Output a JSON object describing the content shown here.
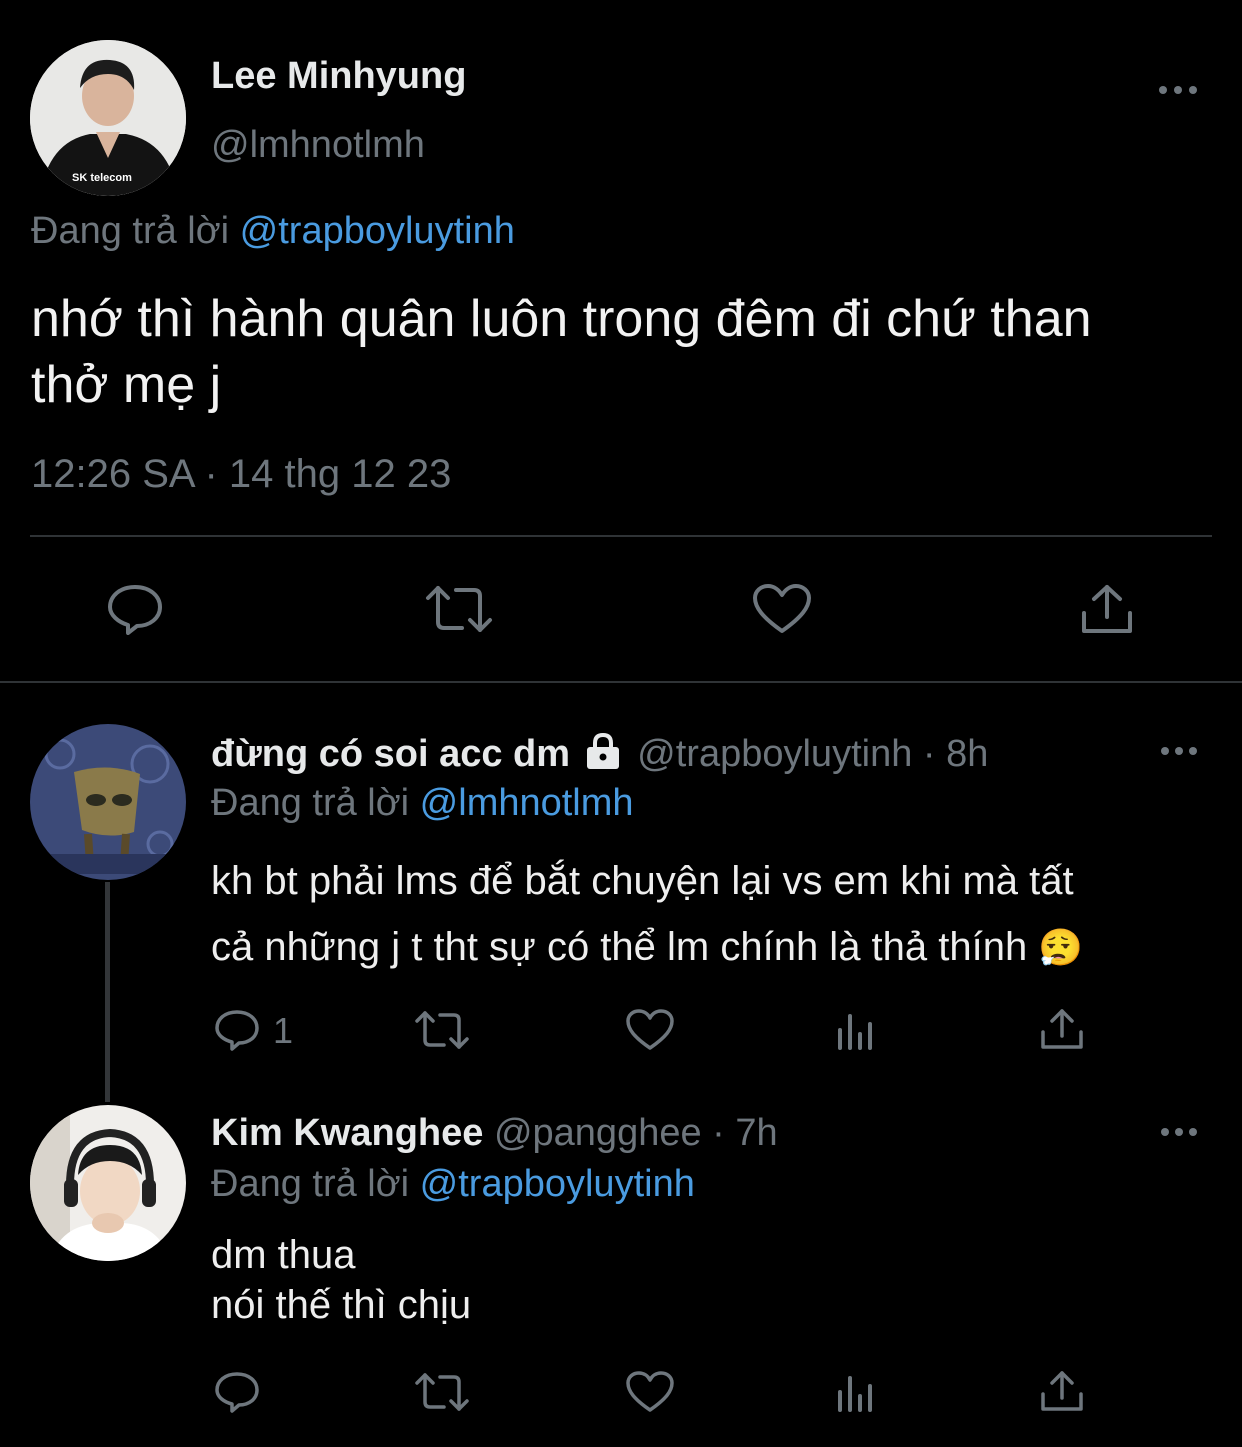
{
  "main_tweet": {
    "display_name": "Lee Minhyung",
    "handle": "@lmhnotlmh",
    "replying_prefix": "Đang trả lời",
    "replying_to": "@trapboyluytinh",
    "text_line1": "nhớ thì hành quân luôn trong đêm đi chứ than",
    "text_line2": "thở mẹ j",
    "timestamp": "12:26 SA · 14 thg 12 23",
    "avatar_badge": "SK telecom"
  },
  "reply1": {
    "display_name": "đừng có soi acc dm",
    "handle_time": "@trapboyluytinh · 8h",
    "replying_prefix": "Đang trả lời",
    "replying_to": "@lmhnotlmh",
    "text_line1": "kh bt phải lms để bắt chuyện lại vs em khi mà tất",
    "text_line2": "cả những j t tht sự có thể lm chính là thả thính",
    "emoji": "😮‍💨",
    "reply_count": "1"
  },
  "reply2": {
    "display_name": "Kim Kwanghee",
    "handle_time": "@pangghee · 7h",
    "replying_prefix": "Đang trả lời",
    "replying_to": "@trapboyluytinh",
    "text_line1": "dm thua",
    "text_line2": "nói thế thì chịu"
  },
  "colors": {
    "background": "#000000",
    "text": "#e7e9ea",
    "muted": "#6e767d",
    "link": "#4a9be0",
    "divider": "#2f3336"
  },
  "icons": [
    "more-icon",
    "reply-icon",
    "retweet-icon",
    "like-icon",
    "share-icon",
    "views-icon",
    "lock-icon"
  ]
}
